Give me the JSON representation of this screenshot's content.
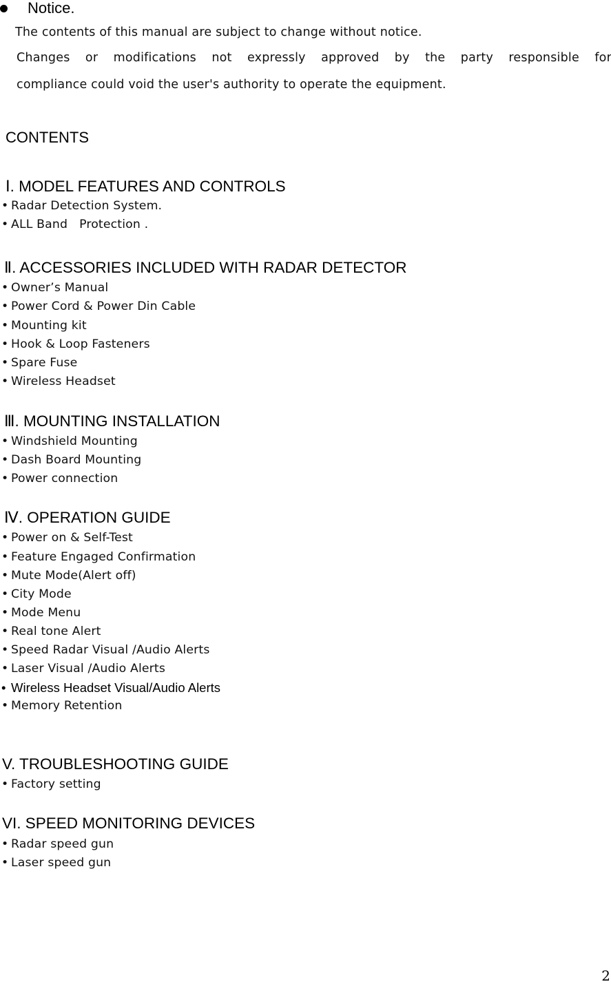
{
  "notice": {
    "title": "Notice.",
    "lines": [
      "The contents of this manual are subject to change without notice.",
      "Changes or modifications not expressly approved by the party responsible for",
      "compliance could void the user's authority to operate the equipment."
    ]
  },
  "contents": {
    "title": "CONTENTS",
    "sections": [
      {
        "heading": "Ⅰ. MODEL FEATURES AND CONTROLS",
        "items": [
          "Radar Detection System.",
          "ALL Band   Protection ."
        ]
      },
      {
        "heading": "Ⅱ. ACCESSORIES INCLUDED WITH RADAR DETECTOR",
        "items": [
          "Owner’s Manual",
          "Power Cord & Power Din Cable",
          "Mounting kit",
          "Hook & Loop Fasteners",
          "Spare Fuse",
          "Wireless Headset"
        ]
      },
      {
        "heading": "Ⅲ. MOUNTING INSTALLATION",
        "items": [
          "Windshield Mounting",
          "Dash Board Mounting",
          "Power connection"
        ]
      },
      {
        "heading": "Ⅳ. OPERATION GUIDE",
        "items": [
          "Power on & Self-Test",
          "Feature Engaged Confirmation",
          "Mute Mode(Alert off)",
          "City Mode",
          "Mode Menu",
          "Real tone Alert",
          "Speed Radar Visual /Audio Alerts",
          "Laser Visual /Audio Alerts",
          "Wireless Headset Visual/Audio Alerts",
          "Memory Retention"
        ]
      },
      {
        "heading": "V. TROUBLESHOOTING GUIDE",
        "items": [
          "Factory setting"
        ]
      },
      {
        "heading": "VI. SPEED MONITORING DEVICES",
        "items": [
          "Radar speed gun",
          "Laser speed gun"
        ]
      }
    ]
  },
  "bullet_char": "•",
  "page_number": "2"
}
